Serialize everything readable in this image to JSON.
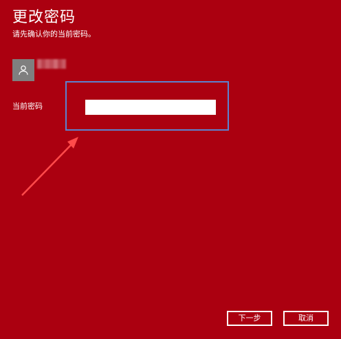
{
  "dialog": {
    "title": "更改密码",
    "subtitle": "请先确认你的当前密码。"
  },
  "account": {
    "avatar_icon": "user-icon",
    "name": ""
  },
  "form": {
    "current_password_label": "当前密码",
    "current_password_value": ""
  },
  "buttons": {
    "next_label": "下一步",
    "cancel_label": "取消"
  },
  "colors": {
    "background": "#ab0010",
    "highlight_border": "#5b82d1",
    "arrow": "#ff4a4a"
  }
}
